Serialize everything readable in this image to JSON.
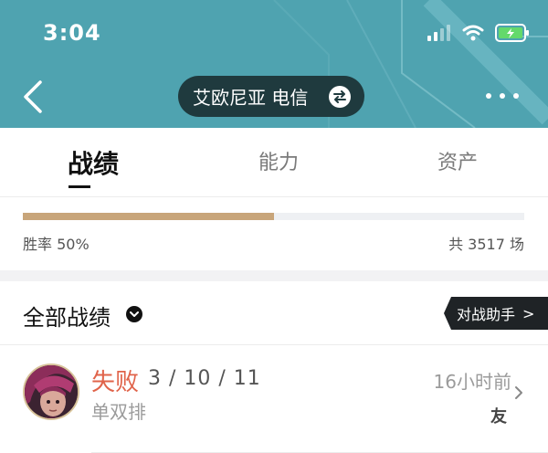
{
  "status_bar": {
    "time": "3:04",
    "icons": [
      "cellular-signal-icon",
      "wifi-icon",
      "battery-charging-icon"
    ]
  },
  "header": {
    "back_icon": "chevron-left-icon",
    "server_label": "艾欧尼亚 电信",
    "switch_icon": "swap-arrows-icon",
    "more_icon": "more-dots-icon",
    "background_color": "#4fa3b0"
  },
  "tabs": [
    {
      "label": "战绩",
      "active": true
    },
    {
      "label": "能力",
      "active": false
    },
    {
      "label": "资产",
      "active": false
    }
  ],
  "win_rate": {
    "label": "胜率 50%",
    "value": 0.5,
    "total_label": "共 3517 场",
    "bar_color": "#c8a57a"
  },
  "section": {
    "title": "全部战绩",
    "dropdown_icon": "chevron-down-icon",
    "assist_button": "对战助手",
    "assist_arrow": ">"
  },
  "matches": [
    {
      "avatar_icon": "champion-avatar",
      "result": "失败",
      "result_color": "#e0634a",
      "kda": "3 / 10 / 11",
      "mode": "单双排",
      "time_ago": "16小时前",
      "friend_tag": "友",
      "chevron_icon": "chevron-right-icon"
    }
  ]
}
